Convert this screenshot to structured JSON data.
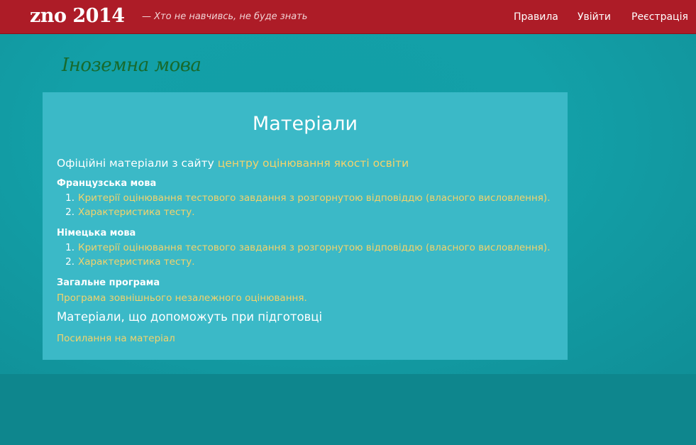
{
  "header": {
    "brand": "zno 2014",
    "tagline": "— Хто не навчивсь, не буде знать",
    "nav": {
      "rules": "Правила",
      "login": "Увійти",
      "register": "Реєстрація"
    }
  },
  "page": {
    "heading": "Іноземна мова"
  },
  "materials": {
    "title": "Матеріали",
    "official_prefix": "Офіційні матеріали з сайту",
    "official_link": "центру оцінювання якості освіти",
    "sections": [
      {
        "heading": "Французська мова",
        "items": [
          {
            "num": "1.",
            "text": "Критерії оцінювання тестового завдання з розгорнутою відповіддю (власного висловлення)."
          },
          {
            "num": "2.",
            "text": "Характеристика тесту."
          }
        ]
      },
      {
        "heading": "Німецька мова",
        "items": [
          {
            "num": "1.",
            "text": "Критерії оцінювання тестового завдання з розгорнутою відповіддю (власного висловлення)."
          },
          {
            "num": "2.",
            "text": "Характеристика тесту."
          }
        ]
      }
    ],
    "general_heading": "Загальне програма",
    "general_link": "Програма зовнішнього незалежного оцінювання.",
    "help_heading": "Матеріали, що допоможуть при підготовці",
    "help_link": "Посилання на матеріал"
  },
  "colors": {
    "navbar": "#ad1c27",
    "background": "#13a0a8",
    "panel": "#3bb9c7",
    "link": "#f4d36b",
    "heading_green": "#176a2d"
  }
}
